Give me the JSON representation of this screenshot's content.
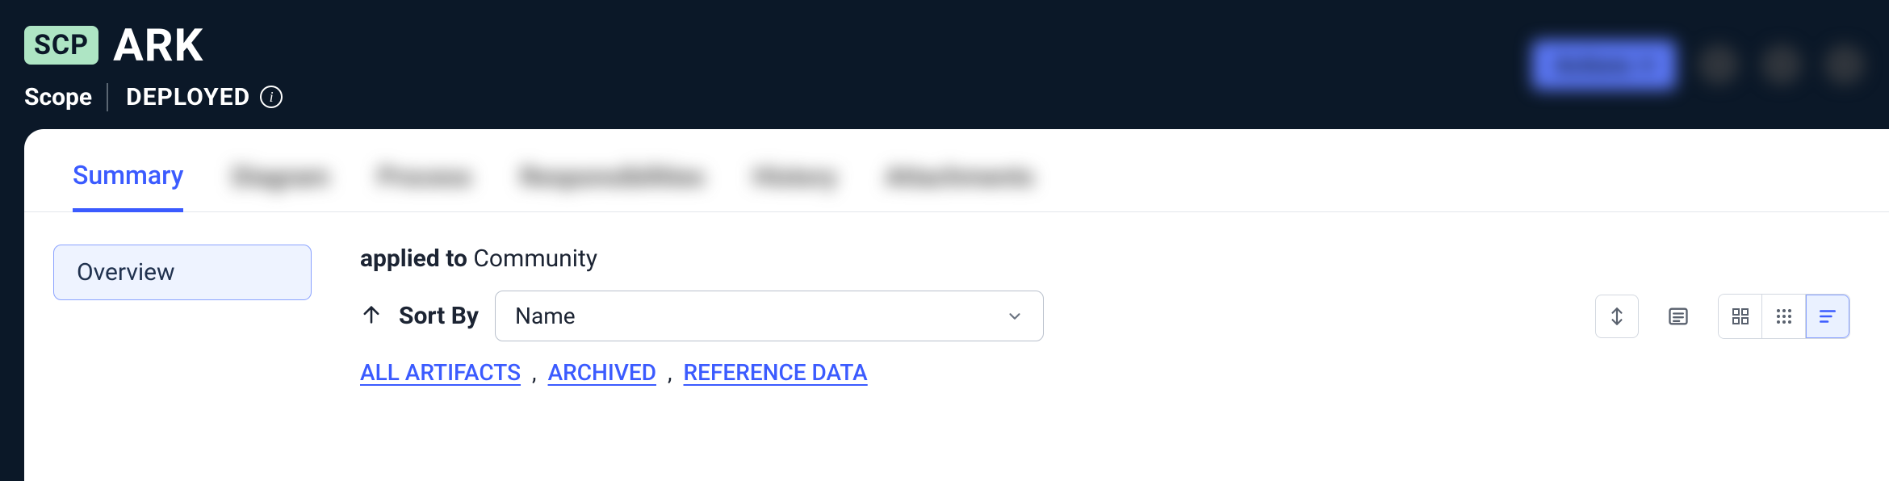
{
  "header": {
    "badge": "SCP",
    "title": "ARK",
    "scope_label": "Scope",
    "status_label": "DEPLOYED",
    "primary_action": "Actions"
  },
  "tabs": {
    "active": "Summary",
    "others": [
      "Diagram",
      "Process",
      "Responsibilities",
      "History",
      "Attachments"
    ]
  },
  "sidebar": {
    "active": "Overview"
  },
  "main": {
    "applied_prefix": "applied to",
    "applied_value": "Community",
    "sort_label": "Sort By",
    "sort_value": "Name",
    "facets": [
      "ALL ARTIFACTS",
      "ARCHIVED",
      "REFERENCE DATA"
    ]
  }
}
